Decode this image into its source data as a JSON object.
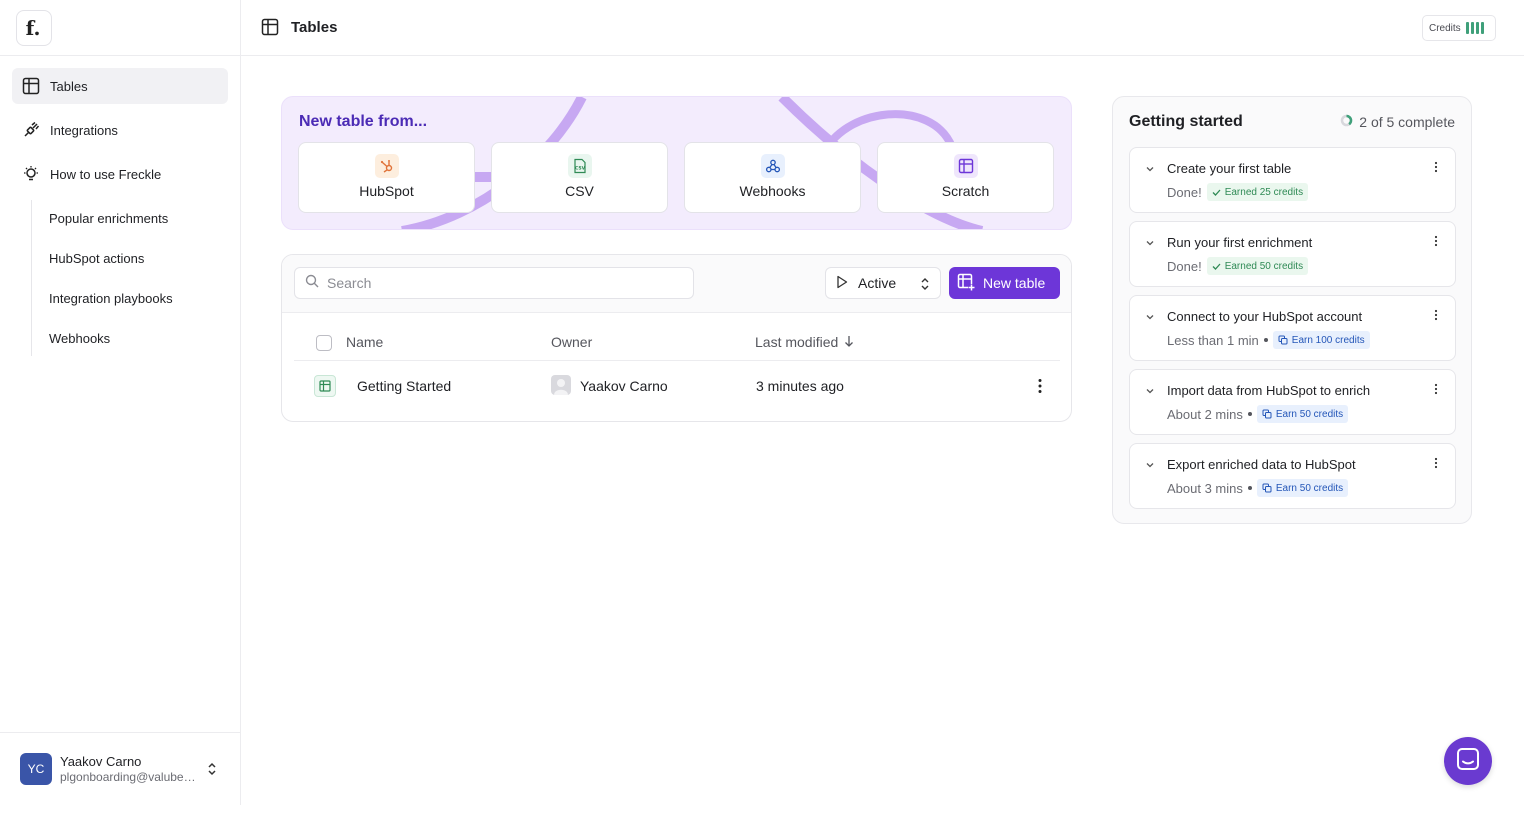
{
  "sidebar": {
    "logo": "f.",
    "nav": [
      {
        "label": "Tables"
      },
      {
        "label": "Integrations"
      },
      {
        "label": "How to use Freckle"
      }
    ],
    "sub_items": [
      {
        "label": "Popular enrichments"
      },
      {
        "label": "HubSpot actions"
      },
      {
        "label": "Integration playbooks"
      },
      {
        "label": "Webhooks"
      }
    ],
    "user": {
      "initials": "YC",
      "name": "Yaakov Carno",
      "email": "plgonboarding@valuberry.com"
    }
  },
  "header": {
    "title": "Tables",
    "credits_label": "Credits"
  },
  "new_table_from": {
    "title": "New table from...",
    "sources": [
      {
        "label": "HubSpot",
        "icon": "hubspot-icon"
      },
      {
        "label": "CSV",
        "icon": "csv-icon"
      },
      {
        "label": "Webhooks",
        "icon": "webhook-icon"
      },
      {
        "label": "Scratch",
        "icon": "table-icon"
      }
    ]
  },
  "tables": {
    "search_placeholder": "Search",
    "filter_value": "Active",
    "new_table_label": "New table",
    "columns": [
      "Name",
      "Owner",
      "Last modified"
    ],
    "rows": [
      {
        "name": "Getting Started",
        "owner": "Yaakov Carno",
        "modified": "3 minutes ago"
      }
    ]
  },
  "getting_started": {
    "title": "Getting started",
    "progress": "2 of 5 complete",
    "steps": [
      {
        "title": "Create your first table",
        "status": "Done!",
        "badge": "Earned 25 credits",
        "done": true
      },
      {
        "title": "Run your first enrichment",
        "status": "Done!",
        "badge": "Earned 50 credits",
        "done": true
      },
      {
        "title": "Connect to your HubSpot account",
        "status": "Less than 1 min",
        "badge": "Earn 100 credits",
        "done": false
      },
      {
        "title": "Import data from HubSpot to enrich",
        "status": "About 2 mins",
        "badge": "Earn 50 credits",
        "done": false
      },
      {
        "title": "Export enriched data to HubSpot",
        "status": "About 3 mins",
        "badge": "Earn 50 credits",
        "done": false
      }
    ]
  },
  "colors": {
    "accent": "#6d36d8",
    "panel_bg": "#f3ecfd",
    "success": "#3fa07a"
  }
}
